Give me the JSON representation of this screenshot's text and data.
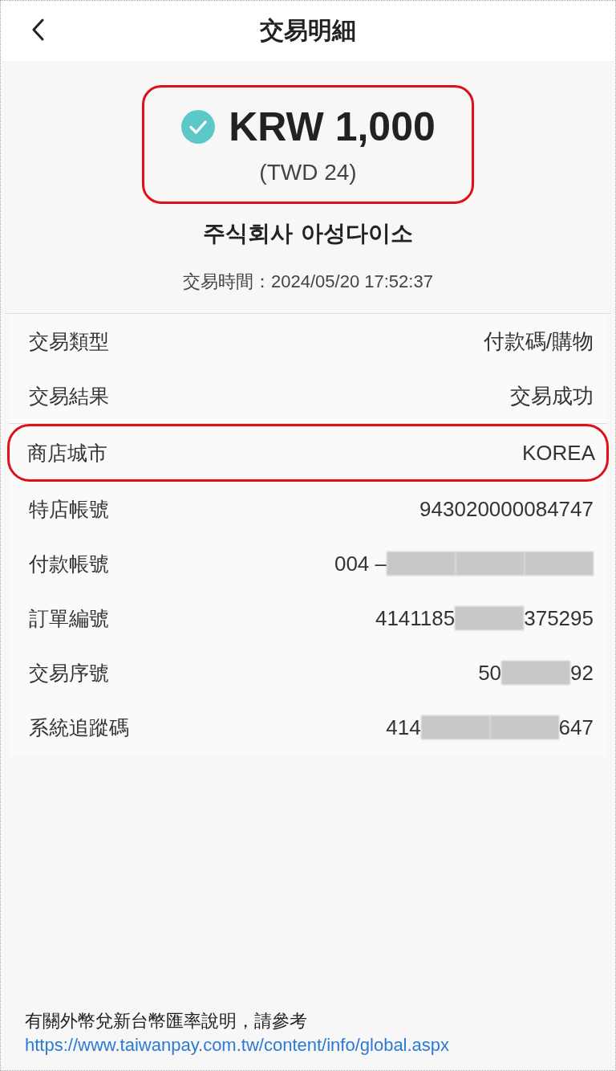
{
  "header": {
    "title": "交易明細"
  },
  "summary": {
    "succeeded": true,
    "highlighted": true,
    "amount": "KRW 1,000",
    "converted": "(TWD 24)",
    "merchant": "주식회사 아성다이소",
    "time_label": "交易時間：",
    "time": "2024/05/20 17:52:37"
  },
  "sections": [
    {
      "rows": [
        {
          "label": "交易類型",
          "highlighted": false,
          "value": [
            {
              "kind": "text",
              "text": "付款碼/購物"
            }
          ]
        },
        {
          "label": "交易結果",
          "highlighted": false,
          "value": [
            {
              "kind": "text",
              "text": "交易成功"
            }
          ]
        }
      ]
    },
    {
      "rows": [
        {
          "label": "商店城市",
          "highlighted": true,
          "value": [
            {
              "kind": "text",
              "text": "KOREA"
            }
          ]
        },
        {
          "label": "特店帳號",
          "highlighted": false,
          "value": [
            {
              "kind": "text",
              "text": "943020000084747"
            }
          ]
        },
        {
          "label": "付款帳號",
          "highlighted": false,
          "value": [
            {
              "kind": "text",
              "text": "004 –"
            },
            {
              "kind": "blur"
            },
            {
              "kind": "blur"
            },
            {
              "kind": "blur"
            }
          ]
        },
        {
          "label": "訂單編號",
          "highlighted": false,
          "value": [
            {
              "kind": "text",
              "text": "4141185"
            },
            {
              "kind": "blur"
            },
            {
              "kind": "text",
              "text": "375295"
            }
          ]
        },
        {
          "label": "交易序號",
          "highlighted": false,
          "value": [
            {
              "kind": "text",
              "text": "50"
            },
            {
              "kind": "blur"
            },
            {
              "kind": "text",
              "text": "92"
            }
          ]
        },
        {
          "label": "系統追蹤碼",
          "highlighted": false,
          "value": [
            {
              "kind": "text",
              "text": "414"
            },
            {
              "kind": "blur"
            },
            {
              "kind": "blur"
            },
            {
              "kind": "text",
              "text": "647"
            }
          ]
        }
      ]
    }
  ],
  "footer": {
    "note": "有關外幣兌新台幣匯率說明，請參考",
    "link": "https://www.taiwanpay.com.tw/content/info/global.aspx"
  }
}
